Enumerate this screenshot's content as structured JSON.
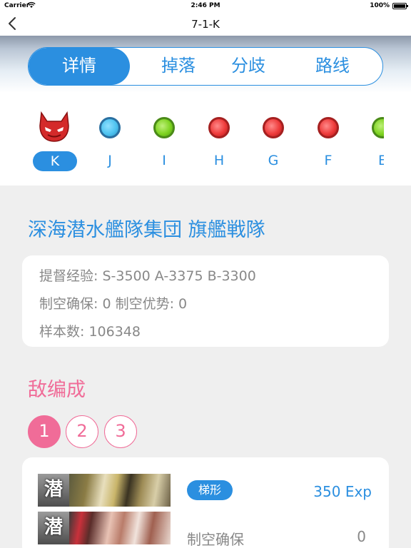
{
  "status": {
    "carrier": "Carrier",
    "time": "2:46 PM",
    "battery": "100%"
  },
  "nav": {
    "title": "7-1-K"
  },
  "tabs": [
    {
      "label": "详情"
    },
    {
      "label": "掉落"
    },
    {
      "label": "分歧"
    },
    {
      "label": "路线"
    }
  ],
  "nodes": [
    {
      "label": "K",
      "icon": "demon-icon",
      "color": "#d42a2a"
    },
    {
      "label": "J",
      "icon": "cyan-dot",
      "color": "#4ec3f0"
    },
    {
      "label": "I",
      "icon": "green-dot",
      "color": "#7ed321"
    },
    {
      "label": "H",
      "icon": "red-dot",
      "color": "#ee3b3b"
    },
    {
      "label": "G",
      "icon": "red-dot",
      "color": "#ee3b3b"
    },
    {
      "label": "F",
      "icon": "red-dot",
      "color": "#ee3b3b"
    },
    {
      "label": "E",
      "icon": "green-dot",
      "color": "#7ed321"
    }
  ],
  "fleet_name": "深海潜水艦隊集団 旗艦戦隊",
  "info": {
    "exp": "提督经验: S-3500 A-3375 B-3300",
    "air": "制空确保: 0  制空优势: 0",
    "samples": "样本数: 106348"
  },
  "enemy": {
    "title": "敌编成",
    "formations": [
      "1",
      "2",
      "3"
    ],
    "ship_badge": "潜",
    "formation_type": "梯形",
    "exp_reward": "350 Exp",
    "air_label": "制空确保",
    "air_value": "0"
  },
  "colors": {
    "accent": "#2b8fe0",
    "pink": "#f06c98"
  }
}
